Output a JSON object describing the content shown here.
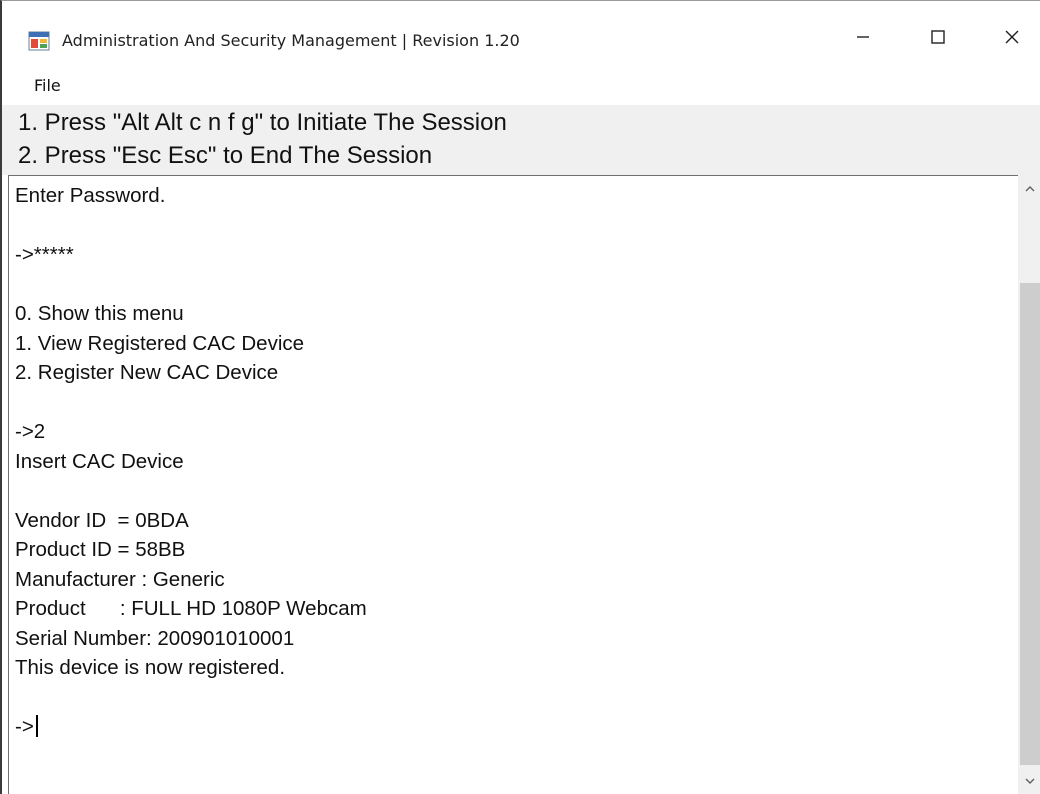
{
  "window": {
    "title": "Administration And Security Management  |  Revision 1.20",
    "controls": {
      "minimize_icon": "minimize-icon",
      "maximize_icon": "maximize-icon",
      "close_icon": "close-icon"
    },
    "app_icon": "app-window-icon"
  },
  "menu": {
    "file_label": "File"
  },
  "instructions": {
    "line1": "1. Press \"Alt Alt c n f g\" to Initiate The Session",
    "line2": "2. Press \"Esc Esc\" to End The Session"
  },
  "console": {
    "lines": [
      "Enter Password.",
      "",
      "->*****",
      "",
      "0. Show this menu",
      "1. View Registered CAC Device",
      "2. Register New CAC Device",
      "",
      "->2",
      "Insert CAC Device",
      "",
      "Vendor ID  = 0BDA",
      "Product ID = 58BB",
      "Manufacturer : Generic",
      "Product      : FULL HD 1080P Webcam",
      "Serial Number: 200901010001",
      "This device is now registered.",
      "",
      "->"
    ],
    "prompt_line_index": 18
  },
  "scrollbar": {
    "up_icon": "chevron-up-icon",
    "down_icon": "chevron-down-icon",
    "position_fraction": 0.2
  },
  "colors": {
    "instruction_bg": "#f0f0f0",
    "scrollbar_track": "#f0f0f0",
    "scrollbar_thumb": "#cdcdcd",
    "text": "#111111"
  }
}
